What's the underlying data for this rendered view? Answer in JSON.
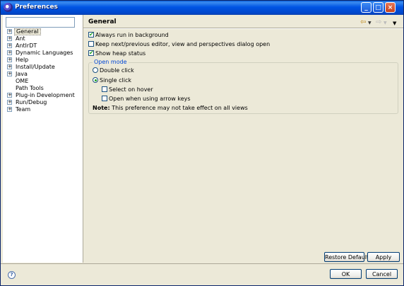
{
  "window": {
    "title": "Preferences"
  },
  "tree": {
    "filter_value": "",
    "items": [
      {
        "label": "General",
        "expandable": true,
        "selected": true
      },
      {
        "label": "Ant",
        "expandable": true,
        "selected": false
      },
      {
        "label": "AntlrDT",
        "expandable": true,
        "selected": false
      },
      {
        "label": "Dynamic Languages",
        "expandable": true,
        "selected": false
      },
      {
        "label": "Help",
        "expandable": true,
        "selected": false
      },
      {
        "label": "Install/Update",
        "expandable": true,
        "selected": false
      },
      {
        "label": "Java",
        "expandable": true,
        "selected": false
      },
      {
        "label": "OME",
        "expandable": false,
        "selected": false
      },
      {
        "label": "Path Tools",
        "expandable": false,
        "selected": false
      },
      {
        "label": "Plug-in Development",
        "expandable": true,
        "selected": false
      },
      {
        "label": "Run/Debug",
        "expandable": true,
        "selected": false
      },
      {
        "label": "Team",
        "expandable": true,
        "selected": false
      }
    ]
  },
  "page": {
    "title": "General",
    "options": {
      "always_run": {
        "label": "Always run in background",
        "checked": true
      },
      "keep_next": {
        "label": "Keep next/previous editor, view and perspectives dialog open",
        "checked": false
      },
      "show_heap": {
        "label": "Show heap status",
        "checked": true
      }
    },
    "open_mode": {
      "title": "Open mode",
      "double_click": {
        "label": "Double click",
        "selected": false
      },
      "single_click": {
        "label": "Single click",
        "selected": true
      },
      "select_on_hover": {
        "label": "Select on hover",
        "checked": false
      },
      "open_arrow": {
        "label": "Open when using arrow keys",
        "checked": false
      },
      "note_label": "Note:",
      "note_text": "This preference may not take effect on all views"
    }
  },
  "buttons": {
    "restore_defaults": "Restore Defaults",
    "apply": "Apply",
    "ok": "OK",
    "cancel": "Cancel"
  }
}
